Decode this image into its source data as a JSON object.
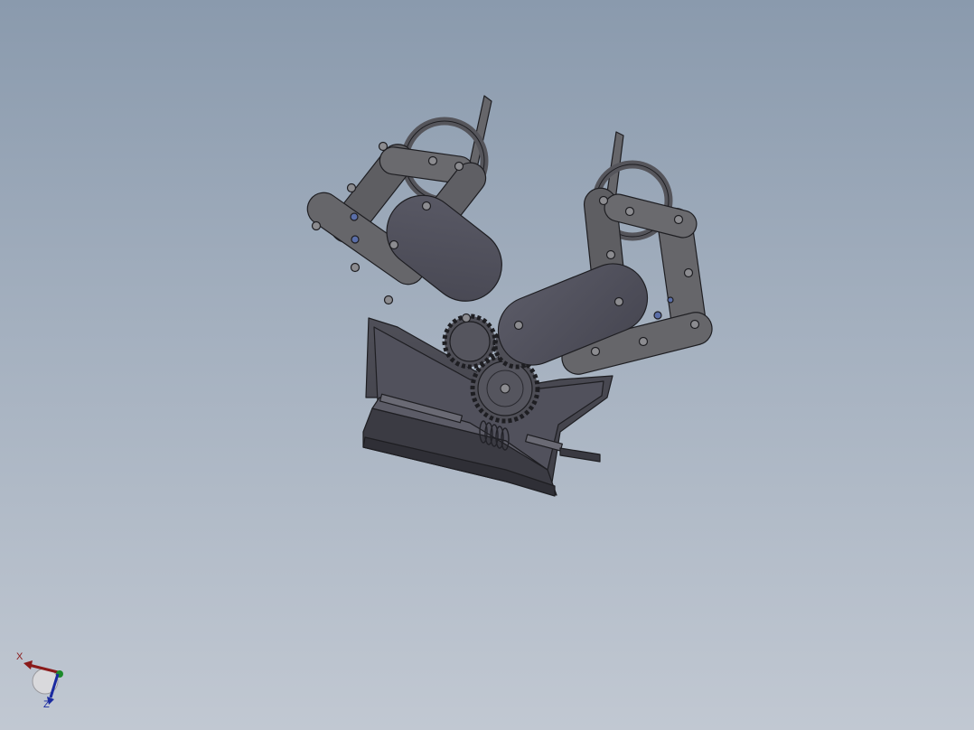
{
  "viewport": {
    "background_top": "#8a9aad",
    "background_bottom": "#c1c8d2"
  },
  "model": {
    "name": "gripper-assembly",
    "body_color": "#55555b",
    "link_color": "#66666a",
    "edge_color": "#1e1e22",
    "hole_color": "#8c8c90"
  },
  "triad": {
    "x_label": "X",
    "z_label": "Z",
    "x_color": "#8a1a1a",
    "y_color": "#1c8a2a",
    "z_color": "#1a2aa0"
  }
}
